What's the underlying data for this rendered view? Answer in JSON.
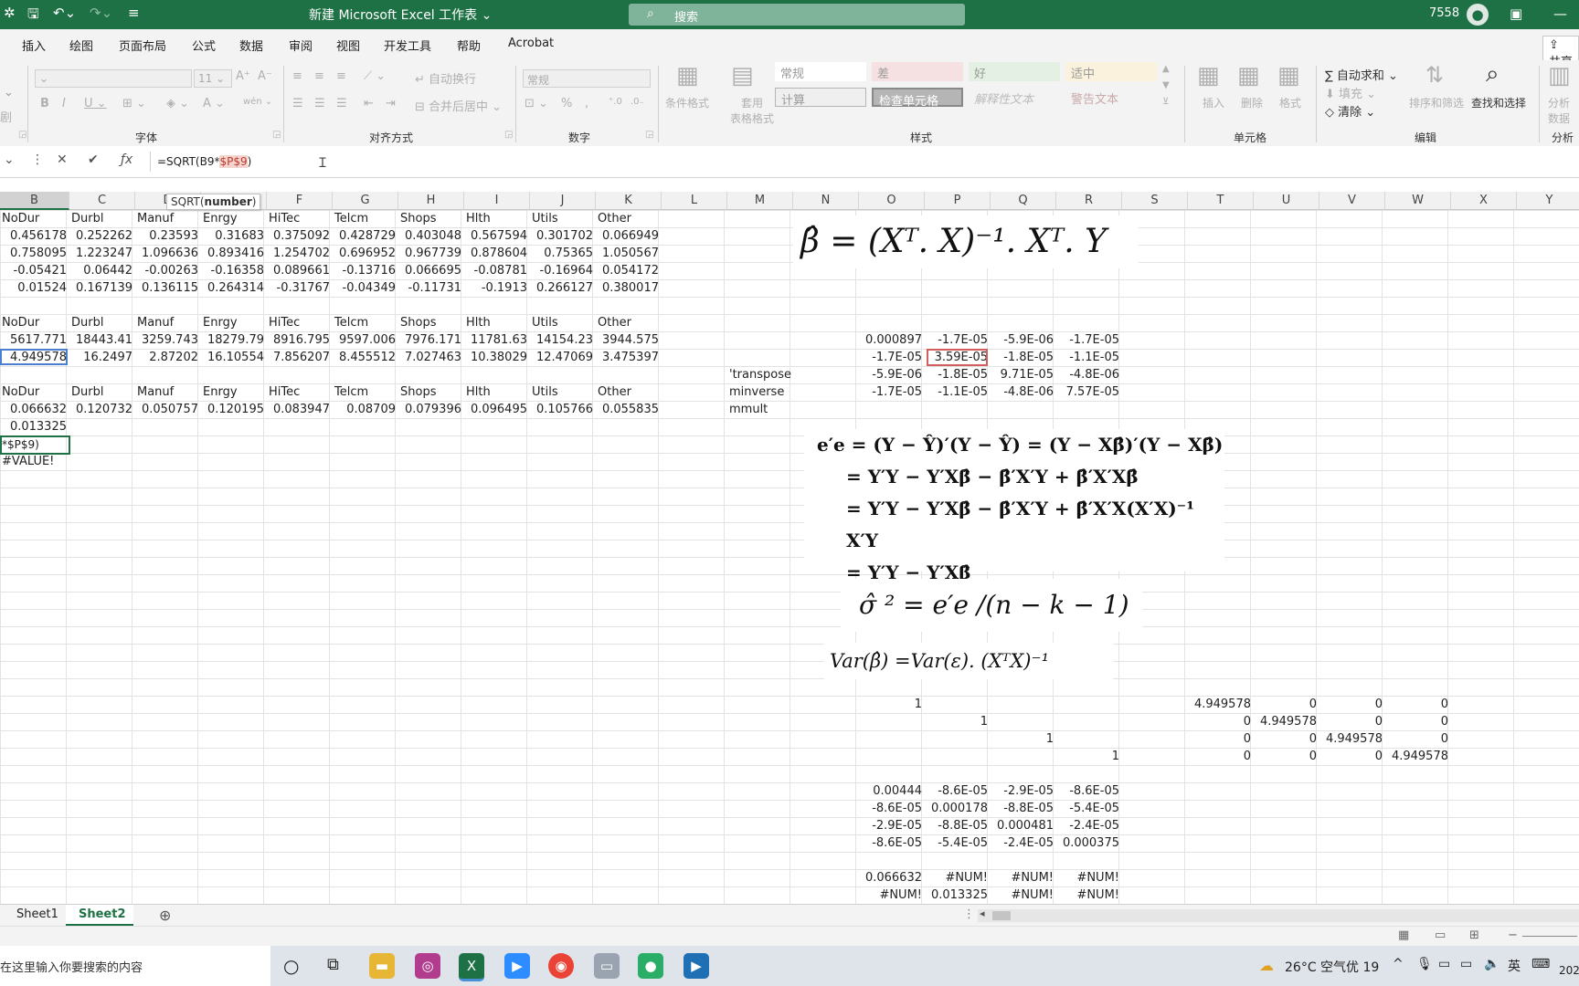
{
  "titlebar": {
    "title": "新建 Microsoft Excel 工作表 ⌄",
    "search_placeholder": "搜索",
    "user": "7558"
  },
  "menu_tabs": [
    "插入",
    "绘图",
    "页面布局",
    "公式",
    "数据",
    "审阅",
    "视图",
    "开发工具",
    "帮助",
    "Acrobat"
  ],
  "share_label": "共享",
  "ribbon": {
    "font_size": "11",
    "number_format": "常规",
    "wrap_text": "自动换行",
    "merge_center": "合并后居中",
    "cond_format": "条件格式",
    "table_format": "套用\n表格格式",
    "styles": [
      "常规",
      "差",
      "好",
      "适中",
      "计算",
      "检查单元格",
      "解释性文本",
      "警告文本"
    ],
    "cells_buttons": [
      "插入",
      "删除",
      "格式"
    ],
    "edit_buttons": [
      "自动求和",
      "填充",
      "清除",
      "排序和筛选",
      "查找和选择"
    ],
    "analysis_button": "分析\n数据",
    "groups": [
      "字体",
      "对齐方式",
      "数字",
      "样式",
      "单元格",
      "编辑",
      "分析"
    ],
    "left_stub": "剧"
  },
  "formula_bar": {
    "prefix": "=SQRT(B9*",
    "ref": "$P$9",
    "suffix": ")",
    "tooltip_fn": "SQRT(",
    "tooltip_arg": "number",
    "tooltip_end": ")"
  },
  "columns": [
    "B",
    "C",
    "D",
    "E",
    "F",
    "G",
    "H",
    "I",
    "J",
    "K",
    "L",
    "M",
    "N",
    "O",
    "P",
    "Q",
    "R",
    "S",
    "T",
    "U",
    "V",
    "W",
    "X",
    "Y"
  ],
  "table_headers": [
    "NoDur",
    "Durbl",
    "Manuf",
    "Enrgy",
    "HiTec",
    "Telcm",
    "Shops",
    "Hlth",
    "Utils",
    "Other"
  ],
  "block1": [
    [
      "0.456178",
      "0.252262",
      "0.23593",
      "0.31683",
      "0.375092",
      "0.428729",
      "0.403048",
      "0.567594",
      "0.301702",
      "0.066949"
    ],
    [
      "0.758095",
      "1.223247",
      "1.096636",
      "0.893416",
      "1.254702",
      "0.696952",
      "0.967739",
      "0.878604",
      "0.75365",
      "1.050567"
    ],
    [
      "-0.05421",
      "0.06442",
      "-0.00263",
      "-0.16358",
      "0.089661",
      "-0.13716",
      "0.066695",
      "-0.08781",
      "-0.16964",
      "0.054172"
    ],
    [
      "0.01524",
      "0.167139",
      "0.136115",
      "0.264314",
      "-0.31767",
      "-0.04349",
      "-0.11731",
      "-0.1913",
      "0.266127",
      "0.380017"
    ]
  ],
  "block2": [
    [
      "5617.771",
      "18443.41",
      "3259.743",
      "18279.79",
      "8916.795",
      "9597.006",
      "7976.171",
      "11781.63",
      "14154.23",
      "3944.575"
    ],
    [
      "4.949578",
      "16.2497",
      "2.87202",
      "16.10554",
      "7.856207",
      "8.455512",
      "7.027463",
      "10.38029",
      "12.47069",
      "3.475397"
    ]
  ],
  "block3": [
    [
      "0.066632",
      "0.120732",
      "0.050757",
      "0.120195",
      "0.083947",
      "0.08709",
      "0.079396",
      "0.096495",
      "0.105766",
      "0.055835"
    ]
  ],
  "b_extra": [
    "0.013325",
    "*$P$9)",
    "#VALUE!"
  ],
  "m_labels": [
    "'transpose",
    "minverse",
    "mmult"
  ],
  "inv_matrix": [
    [
      "0.000897",
      "-1.7E-05",
      "-5.9E-06",
      "-1.7E-05"
    ],
    [
      "-1.7E-05",
      "3.59E-05",
      "-1.8E-05",
      "-1.1E-05"
    ],
    [
      "-5.9E-06",
      "-1.8E-05",
      "9.71E-05",
      "-4.8E-06"
    ],
    [
      "-1.7E-05",
      "-1.1E-05",
      "-4.8E-06",
      "7.57E-05"
    ]
  ],
  "identity": [
    "1",
    "1",
    "1",
    "1"
  ],
  "diag_matrix": [
    [
      "4.949578",
      "0",
      "0",
      "0"
    ],
    [
      "0",
      "4.949578",
      "0",
      "0"
    ],
    [
      "0",
      "0",
      "4.949578",
      "0"
    ],
    [
      "0",
      "0",
      "0",
      "4.949578"
    ]
  ],
  "var_matrix": [
    [
      "0.00444",
      "-8.6E-05",
      "-2.9E-05",
      "-8.6E-05"
    ],
    [
      "-8.6E-05",
      "0.000178",
      "-8.8E-05",
      "-5.4E-05"
    ],
    [
      "-2.9E-05",
      "-8.8E-05",
      "0.000481",
      "-2.4E-05"
    ],
    [
      "-8.6E-05",
      "-5.4E-05",
      "-2.4E-05",
      "0.000375"
    ]
  ],
  "se_matrix": [
    [
      "0.066632",
      "#NUM!",
      "#NUM!",
      "#NUM!"
    ],
    [
      "#NUM!",
      "0.013325",
      "#NUM!",
      "#NUM!"
    ]
  ],
  "equations": {
    "beta": "β̂ = (Xᵀ. X)⁻¹. Xᵀ. Y",
    "ee1": "e′e = (Y − Ŷ)′(Y − Ŷ) = (Y − Xβ̂)′(Y − Xβ̂)",
    "ee2": "= Y′Y − Y′Xβ̂ − β̂′X′Y + β̂′X′Xβ̂",
    "ee3": "= Y′Y − Y′Xβ̂ − β̂′X′Y + β̂′X′X(X′X)⁻¹ X′Y",
    "ee4": "= Y′Y − Y′Xβ̂",
    "sigma": "σ̂ ² = e′e /(n − k − 1)",
    "var": "Var(β̂) =Var(ε). (XᵀX)⁻¹"
  },
  "sheets": [
    "Sheet1",
    "Sheet2"
  ],
  "taskbar": {
    "search_placeholder": "在这里输入你要搜索的内容",
    "weather": "26°C 空气优 19",
    "ime": "英",
    "clock": "202"
  },
  "colors": {
    "excel_green": "#1e7145",
    "selection": "#1e7145",
    "error_ref": "#c0392b"
  }
}
